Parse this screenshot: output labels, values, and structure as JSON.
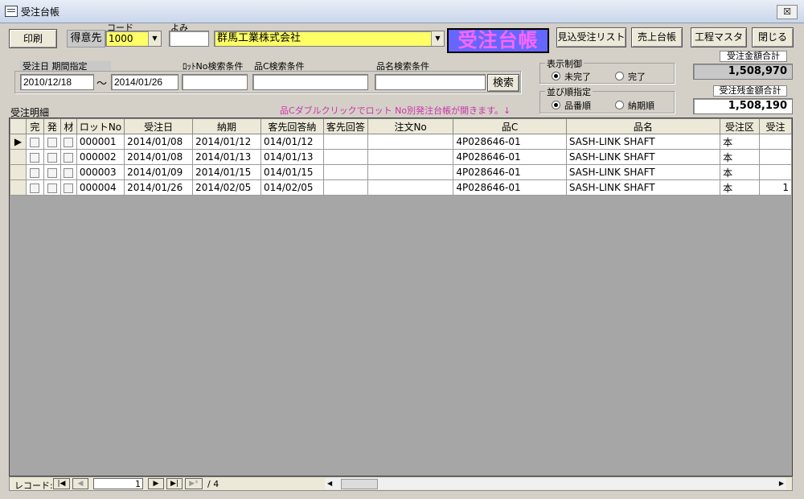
{
  "window": {
    "title": "受注台帳",
    "close_glyph": "☒"
  },
  "toolbar": {
    "print_label": "印刷",
    "customer_label": "得意先",
    "code_label": "コード",
    "code_value": "1000",
    "yomi_label": "よみ",
    "yomi_value": "",
    "company_name": "群馬工業株式会社",
    "form_title": "受注台帳",
    "btn_estimate": "見込受注リスト",
    "btn_sales": "売上台帳",
    "btn_process": "工程マスタ",
    "btn_close": "閉じる"
  },
  "filters": {
    "date_header": "受注日 期間指定",
    "date_from": "2010/12/18",
    "date_sep": "～",
    "date_to": "2014/01/26",
    "lot_label": "ﾛｯﾄNo検索条件",
    "lot_value": "",
    "partc_label": "品C検索条件",
    "partc_value": "",
    "name_label": "品名検索条件",
    "name_value": "",
    "search_button": "検索",
    "hint": "品Cダブルクリックでロット No別発注台帳が開きます。↓"
  },
  "display_control": {
    "title": "表示制御",
    "opt1": "未完了",
    "opt2": "完了",
    "selected": "未完了"
  },
  "sort_control": {
    "title": "並び順指定",
    "opt1": "品番順",
    "opt2": "納期順",
    "selected": "品番順"
  },
  "totals": {
    "order_total_label": "受注金額合計",
    "order_total": "1,508,970",
    "remain_total_label": "受注残金額合計",
    "remain_total": "1,508,190"
  },
  "detail": {
    "label": "受注明細",
    "columns": [
      "完",
      "発",
      "材",
      "ロットNo",
      "受注日",
      "納期",
      "客先回答納",
      "客先回答",
      "注文No",
      "品C",
      "品名",
      "受注区",
      "受注"
    ],
    "rows": [
      {
        "lot": "000001",
        "order_date": "2014/01/08",
        "due": "2014/01/12",
        "answer": "014/01/12",
        "answer2": "",
        "po": "",
        "partc": "4P028646-01",
        "name": "SASH-LINK  SHAFT",
        "unit": "本",
        "qty": ""
      },
      {
        "lot": "000002",
        "order_date": "2014/01/08",
        "due": "2014/01/13",
        "answer": "014/01/13",
        "answer2": "",
        "po": "",
        "partc": "4P028646-01",
        "name": "SASH-LINK  SHAFT",
        "unit": "本",
        "qty": ""
      },
      {
        "lot": "000003",
        "order_date": "2014/01/09",
        "due": "2014/01/15",
        "answer": "014/01/15",
        "answer2": "",
        "po": "",
        "partc": "4P028646-01",
        "name": "SASH-LINK  SHAFT",
        "unit": "本",
        "qty": ""
      },
      {
        "lot": "000004",
        "order_date": "2014/01/26",
        "due": "2014/02/05",
        "answer": "014/02/05",
        "answer2": "",
        "po": "",
        "partc": "4P028646-01",
        "name": "SASH-LINK  SHAFT",
        "unit": "本",
        "qty": "1"
      }
    ]
  },
  "record_nav": {
    "label": "レコード:",
    "current": "1",
    "total_text": "/ 4",
    "first": "|◀",
    "prev": "◀",
    "next": "▶",
    "last": "▶|",
    "new": "▶*"
  }
}
